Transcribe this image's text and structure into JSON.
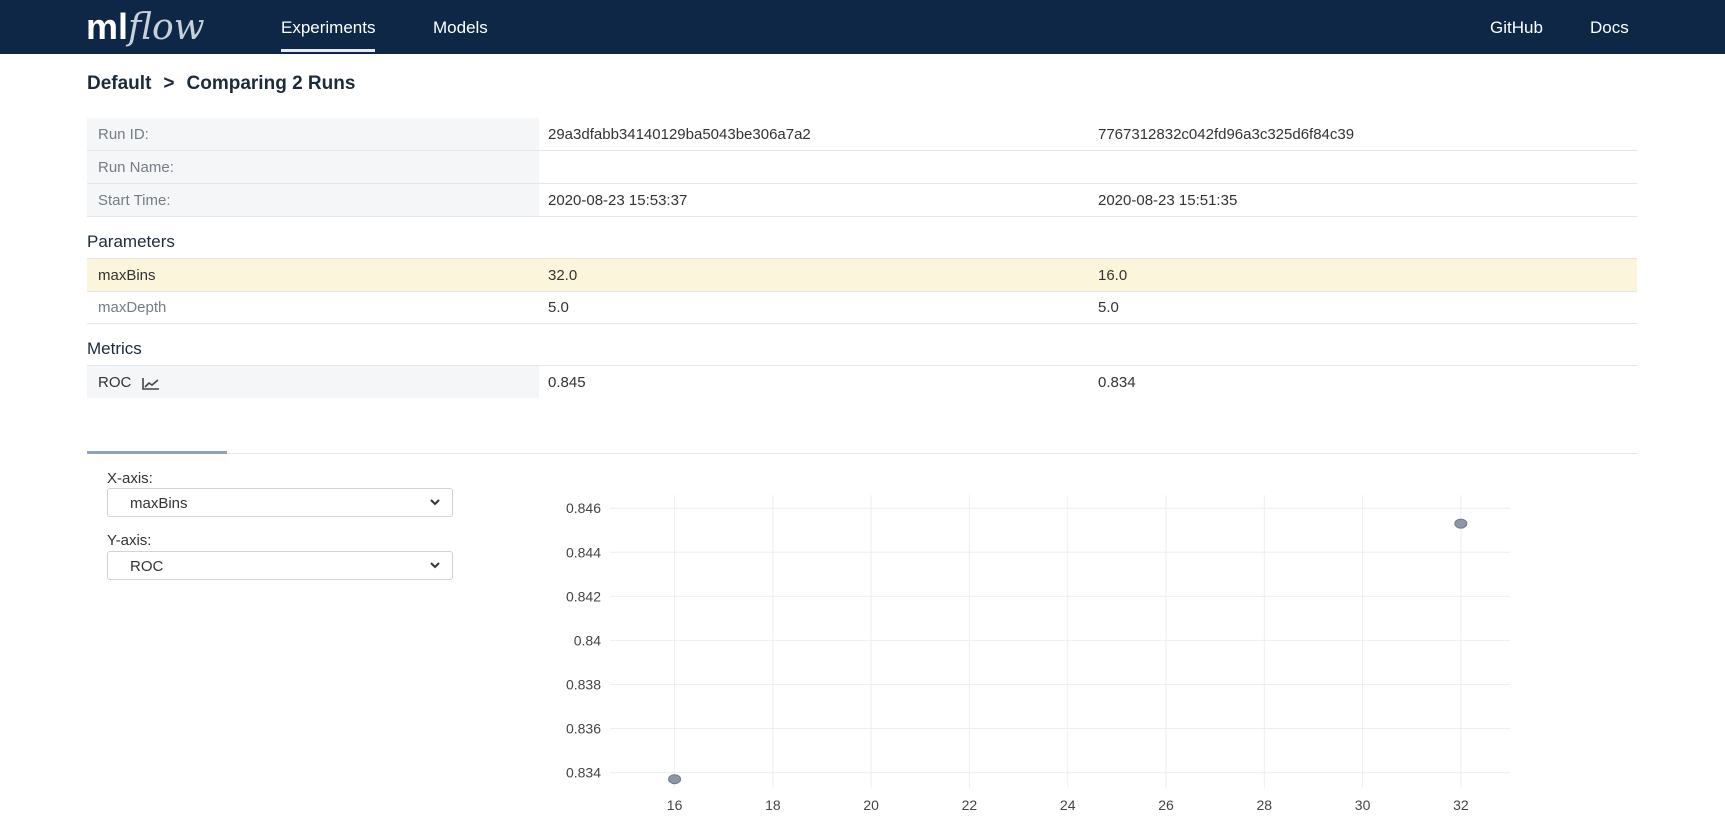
{
  "header": {
    "logo_ml": "ml",
    "logo_flow": "flow",
    "nav": [
      "Experiments",
      "Models"
    ],
    "right_links": [
      "GitHub",
      "Docs"
    ]
  },
  "breadcrumb": {
    "experiment": "Default",
    "separator": ">",
    "page": "Comparing 2 Runs"
  },
  "run_info": {
    "rows": [
      {
        "label": "Run ID:",
        "values": [
          "29a3dfabb34140129ba5043be306a7a2",
          "7767312832c042fd96a3c325d6f84c39"
        ]
      },
      {
        "label": "Run Name:",
        "values": [
          "",
          ""
        ]
      },
      {
        "label": "Start Time:",
        "values": [
          "2020-08-23 15:53:37",
          "2020-08-23 15:51:35"
        ]
      }
    ]
  },
  "parameters": {
    "title": "Parameters",
    "rows": [
      {
        "label": "maxBins",
        "values": [
          "32.0",
          "16.0"
        ],
        "highlight": true
      },
      {
        "label": "maxDepth",
        "values": [
          "5.0",
          "5.0"
        ],
        "highlight": false
      }
    ]
  },
  "metrics": {
    "title": "Metrics",
    "rows": [
      {
        "label": "ROC",
        "values": [
          "0.845",
          "0.834"
        ],
        "icon": "line-chart-icon"
      }
    ]
  },
  "plot_controls": {
    "x_label": "X-axis:",
    "x_value": "maxBins",
    "y_label": "Y-axis:",
    "y_value": "ROC"
  },
  "colors": {
    "header_bg": "#0f2747",
    "highlight_row": "#fbf5dc",
    "marker": "#8c96a6"
  },
  "chart_data": {
    "type": "scatter",
    "x": [
      32,
      16
    ],
    "y": [
      0.8453,
      0.8337
    ],
    "xticks": [
      "16",
      "18",
      "20",
      "22",
      "24",
      "26",
      "28",
      "30",
      "32"
    ],
    "yticks": [
      "0.834",
      "0.836",
      "0.838",
      "0.84",
      "0.842",
      "0.844",
      "0.846"
    ],
    "xlim": [
      15.5,
      33
    ],
    "ylim": [
      0.8333,
      0.8466
    ],
    "grid": true
  }
}
